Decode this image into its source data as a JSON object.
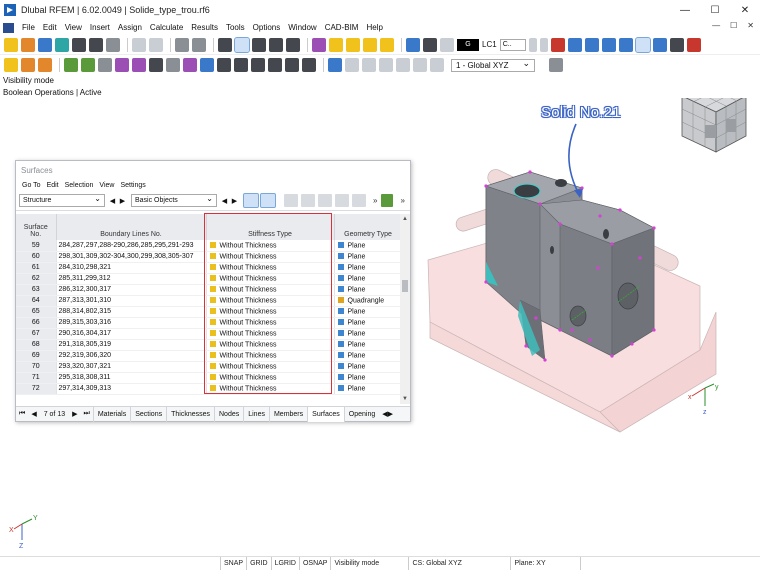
{
  "window": {
    "title": "Dlubal RFEM | 6.02.0049 | Solide_type_trou.rf6",
    "controls": [
      "—",
      "☐",
      "✕"
    ]
  },
  "menu": {
    "items": [
      "File",
      "Edit",
      "View",
      "Insert",
      "Assign",
      "Calculate",
      "Results",
      "Tools",
      "Options",
      "Window",
      "CAD-BIM",
      "Help"
    ],
    "right_controls": [
      "—",
      "☐",
      "✕"
    ]
  },
  "toolbar": {
    "load_case_tag": "G",
    "load_case": "LC1",
    "load_case_drop": "C..",
    "coordinate_system": "1 - Global XYZ"
  },
  "info": {
    "line1": "Visibility mode",
    "line2": "Boolean Operations | Active"
  },
  "viewport": {
    "annotation": "Solid No.21",
    "axis_labels": {
      "x": "x",
      "y": "y",
      "z": "z",
      "big_x": "X",
      "big_y": "Y",
      "big_z": "Z"
    }
  },
  "panel": {
    "title": "Surfaces",
    "menu": [
      "Go To",
      "Edit",
      "Selection",
      "View",
      "Settings"
    ],
    "filter_left": "Structure",
    "filter_right": "Basic Objects",
    "columns": {
      "surface_no_1": "Surface",
      "surface_no_2": "No.",
      "boundary": "Boundary Lines No.",
      "stiffness": "Stiffness Type",
      "geometry": "Geometry Type"
    },
    "rows": [
      {
        "no": "59",
        "lines": "284,287,297,288-290,286,285,295,291-293",
        "stiffness": "Without Thickness",
        "geometry": "Plane",
        "geo_color": "blue"
      },
      {
        "no": "60",
        "lines": "298,301,309,302-304,300,299,308,305-307",
        "stiffness": "Without Thickness",
        "geometry": "Plane",
        "geo_color": "blue"
      },
      {
        "no": "61",
        "lines": "284,310,298,321",
        "stiffness": "Without Thickness",
        "geometry": "Plane",
        "geo_color": "blue"
      },
      {
        "no": "62",
        "lines": "285,311,299,312",
        "stiffness": "Without Thickness",
        "geometry": "Plane",
        "geo_color": "blue"
      },
      {
        "no": "63",
        "lines": "286,312,300,317",
        "stiffness": "Without Thickness",
        "geometry": "Plane",
        "geo_color": "blue"
      },
      {
        "no": "64",
        "lines": "287,313,301,310",
        "stiffness": "Without Thickness",
        "geometry": "Quadrangle",
        "geo_color": "orange"
      },
      {
        "no": "65",
        "lines": "288,314,802,315",
        "stiffness": "Without Thickness",
        "geometry": "Plane",
        "geo_color": "blue"
      },
      {
        "no": "66",
        "lines": "289,315,303,316",
        "stiffness": "Without Thickness",
        "geometry": "Plane",
        "geo_color": "blue"
      },
      {
        "no": "67",
        "lines": "290,316,304,317",
        "stiffness": "Without Thickness",
        "geometry": "Plane",
        "geo_color": "blue"
      },
      {
        "no": "68",
        "lines": "291,318,305,319",
        "stiffness": "Without Thickness",
        "geometry": "Plane",
        "geo_color": "blue"
      },
      {
        "no": "69",
        "lines": "292,319,306,320",
        "stiffness": "Without Thickness",
        "geometry": "Plane",
        "geo_color": "blue"
      },
      {
        "no": "70",
        "lines": "293,320,307,321",
        "stiffness": "Without Thickness",
        "geometry": "Plane",
        "geo_color": "blue"
      },
      {
        "no": "71",
        "lines": "295,318,308,311",
        "stiffness": "Without Thickness",
        "geometry": "Plane",
        "geo_color": "blue"
      },
      {
        "no": "72",
        "lines": "297,314,309,313",
        "stiffness": "Without Thickness",
        "geometry": "Plane",
        "geo_color": "blue"
      }
    ],
    "pager": "7 of 13",
    "tabs": [
      "Materials",
      "Sections",
      "Thicknesses",
      "Nodes",
      "Lines",
      "Members",
      "Surfaces",
      "Opening"
    ],
    "active_tab": "Surfaces"
  },
  "statusbar": {
    "items": [
      "SNAP",
      "GRID",
      "LGRID",
      "OSNAP",
      "Visibility mode"
    ],
    "cs": "CS: Global XYZ",
    "plane": "Plane: XY"
  }
}
